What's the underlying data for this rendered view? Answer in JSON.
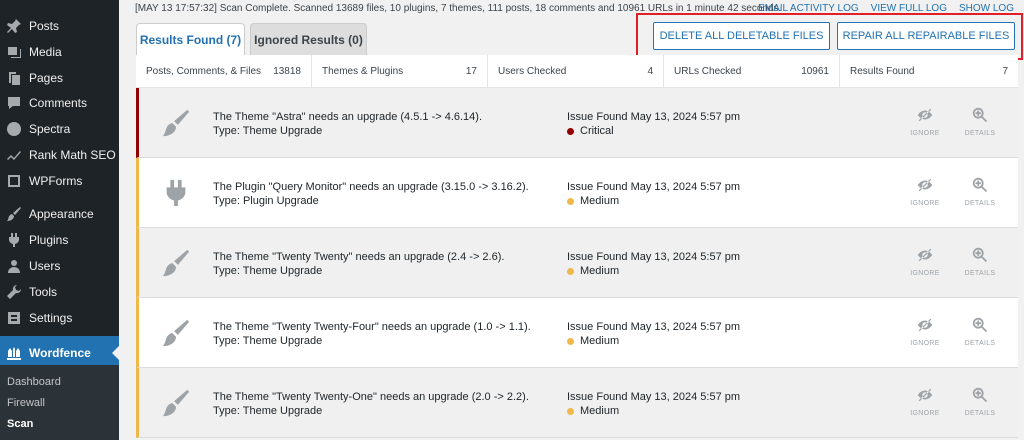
{
  "sidebar": {
    "items": [
      {
        "label": "Posts",
        "icon": "pushpin-icon"
      },
      {
        "label": "Media",
        "icon": "media-icon"
      },
      {
        "label": "Pages",
        "icon": "pages-icon"
      },
      {
        "label": "Comments",
        "icon": "comments-icon"
      },
      {
        "label": "Spectra",
        "icon": "spectra-icon"
      },
      {
        "label": "Rank Math SEO",
        "icon": "rank-math-icon"
      },
      {
        "label": "WPForms",
        "icon": "wpforms-icon"
      },
      {
        "label": "Appearance",
        "icon": "brush-icon"
      },
      {
        "label": "Plugins",
        "icon": "plugin-icon"
      },
      {
        "label": "Users",
        "icon": "users-icon"
      },
      {
        "label": "Tools",
        "icon": "wrench-icon"
      },
      {
        "label": "Settings",
        "icon": "settings-icon"
      },
      {
        "label": "Wordfence",
        "icon": "wordfence-icon"
      }
    ],
    "submenu": [
      "Dashboard",
      "Firewall",
      "Scan"
    ]
  },
  "status": {
    "text": "[MAY 13 17:57:32] Scan Complete. Scanned 13689 files, 10 plugins, 7 themes, 111 posts, 18 comments and 10961 URLs in 1 minute 42 seconds.",
    "links": [
      "EMAIL ACTIVITY LOG",
      "VIEW FULL LOG",
      "SHOW LOG"
    ]
  },
  "tabs": {
    "results": "Results Found (7)",
    "ignored": "Ignored Results (0)"
  },
  "actions": {
    "delete": "DELETE ALL DELETABLE FILES",
    "repair": "REPAIR ALL REPAIRABLE FILES"
  },
  "summary": [
    {
      "label": "Posts, Comments, & Files",
      "value": "13818"
    },
    {
      "label": "Themes & Plugins",
      "value": "17"
    },
    {
      "label": "Users Checked",
      "value": "4"
    },
    {
      "label": "URLs Checked",
      "value": "10961"
    },
    {
      "label": "Results Found",
      "value": "7"
    }
  ],
  "colors": {
    "critical": "#930000",
    "medium": "#f0b849",
    "accent": "#2271b1",
    "highlight": "#e21f26"
  },
  "results": [
    {
      "title": "The Theme \"Astra\" needs an upgrade (4.5.1 -> 4.6.14).",
      "type": "Type: Theme Upgrade",
      "found": "Issue Found May 13, 2024 5:57 pm",
      "severity": "Critical",
      "icon": "brush-icon"
    },
    {
      "title": "The Plugin \"Query Monitor\" needs an upgrade (3.15.0 -> 3.16.2).",
      "type": "Type: Plugin Upgrade",
      "found": "Issue Found May 13, 2024 5:57 pm",
      "severity": "Medium",
      "icon": "plugin-icon"
    },
    {
      "title": "The Theme \"Twenty Twenty\" needs an upgrade (2.4 -> 2.6).",
      "type": "Type: Theme Upgrade",
      "found": "Issue Found May 13, 2024 5:57 pm",
      "severity": "Medium",
      "icon": "brush-icon"
    },
    {
      "title": "The Theme \"Twenty Twenty-Four\" needs an upgrade (1.0 -> 1.1).",
      "type": "Type: Theme Upgrade",
      "found": "Issue Found May 13, 2024 5:57 pm",
      "severity": "Medium",
      "icon": "brush-icon"
    },
    {
      "title": "The Theme \"Twenty Twenty-One\" needs an upgrade (2.0 -> 2.2).",
      "type": "Type: Theme Upgrade",
      "found": "Issue Found May 13, 2024 5:57 pm",
      "severity": "Medium",
      "icon": "brush-icon"
    }
  ],
  "row_actions": {
    "ignore": "IGNORE",
    "details": "DETAILS"
  }
}
